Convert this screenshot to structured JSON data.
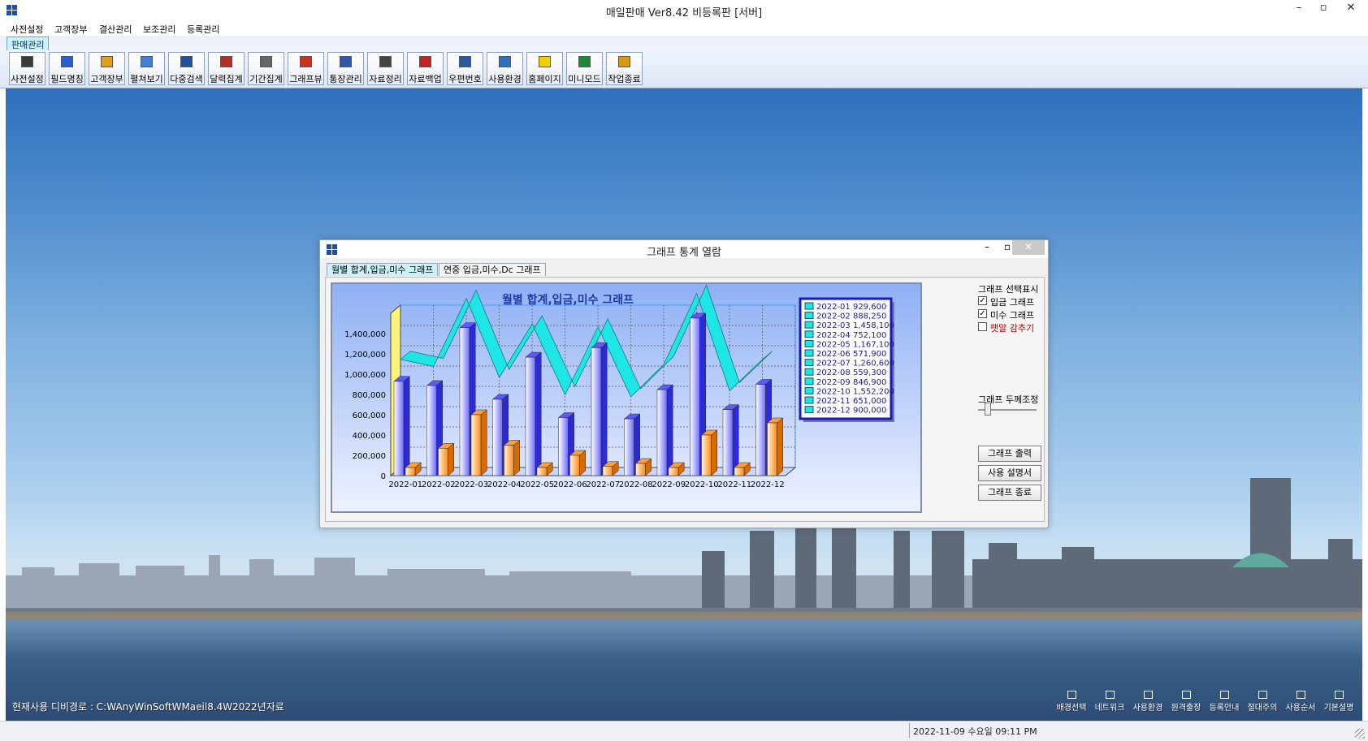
{
  "window": {
    "title": "매일판매 Ver8.42 비등록판 [서버]",
    "minimize": "–",
    "maximize": "▫",
    "close": "✕"
  },
  "menu": [
    "사전설정",
    "고객장부",
    "결산관리",
    "보조관리",
    "등록관리"
  ],
  "doc_tab": "판매관리",
  "toolbar": [
    "사전설정",
    "필드명칭",
    "고객장부",
    "펼쳐보기",
    "다중검색",
    "달력집계",
    "기간집계",
    "그래프뷰",
    "통장관리",
    "자료정리",
    "자료백업",
    "우편번호",
    "사용환경",
    "홈페이지",
    "미니모드",
    "작업종료"
  ],
  "toolbar_icon_colors": [
    "#3a3a3a",
    "#2d5fc9",
    "#e39d18",
    "#3f7fd6",
    "#2050a0",
    "#b0302a",
    "#666666",
    "#c8321e",
    "#2b58b0",
    "#444444",
    "#c82020",
    "#2a5a9a",
    "#2f6fc0",
    "#f0d000",
    "#1a8a3a",
    "#d89a10"
  ],
  "dialog": {
    "title": "그래프 통계 열람",
    "tabs": [
      "월별 합계,입금,미수 그래프",
      "연중 입금,미수,Dc 그래프"
    ],
    "side": {
      "select_label": "그래프 선택표시",
      "checkboxes": [
        {
          "label": "입금 그래프",
          "checked": true
        },
        {
          "label": "미수 그래프",
          "checked": true
        },
        {
          "label": "팻말 감추기",
          "checked": false
        }
      ],
      "thickness_label": "그래프 두께조정",
      "buttons": [
        "그래프 출력",
        "사용 설명서",
        "그래프 종료"
      ]
    }
  },
  "chart_data": {
    "type": "bar",
    "title": "월별 합계,입금,미수 그래프",
    "categories": [
      "2022-01",
      "2022-02",
      "2022-03",
      "2022-04",
      "2022-05",
      "2022-06",
      "2022-07",
      "2022-08",
      "2022-09",
      "2022-10",
      "2022-11",
      "2022-12"
    ],
    "series": [
      {
        "type": "line",
        "values": [
          1050000,
          980000,
          1650000,
          870000,
          1400000,
          700000,
          1370000,
          680000,
          1000000,
          1700000,
          740000,
          1050000
        ],
        "color": "#1ee6e6"
      },
      {
        "type": "bar",
        "values": [
          929600,
          888250,
          1458100,
          752100,
          1167100,
          571900,
          1260600,
          559300,
          846900,
          1552200,
          651000,
          900000
        ],
        "color": "#3a3aff"
      },
      {
        "type": "bar",
        "values": [
          80000,
          270000,
          600000,
          300000,
          80000,
          200000,
          90000,
          120000,
          80000,
          400000,
          80000,
          520000
        ],
        "color": "#ff8a10"
      }
    ],
    "legend": [
      "2022-01 929,600",
      "2022-02 888,250",
      "2022-03 1,458,100",
      "2022-04 752,100",
      "2022-05 1,167,100",
      "2022-06 571,900",
      "2022-07 1,260,600",
      "2022-08 559,300",
      "2022-09 846,900",
      "2022-10 1,552,200",
      "2022-11 651,000",
      "2022-12 900,000"
    ],
    "yticks": [
      "0",
      "200,000",
      "400,000",
      "600,000",
      "800,000",
      "1,000,000",
      "1,200,000",
      "1,400,000"
    ],
    "ylim": [
      0,
      1600000
    ],
    "legend_position": "right",
    "grid": true
  },
  "desktop": {
    "path_text": "현재사용 디비경로 : C:WAnyWinSoftWMaeil8.4W2022년자료",
    "shortcuts": [
      "배경선택",
      "네트워크",
      "사용환경",
      "원격출장",
      "등록안내",
      "절대주의",
      "사용순서",
      "기본설명"
    ]
  },
  "status": {
    "datetime": "2022-11-09 수요일 09:11 PM"
  }
}
